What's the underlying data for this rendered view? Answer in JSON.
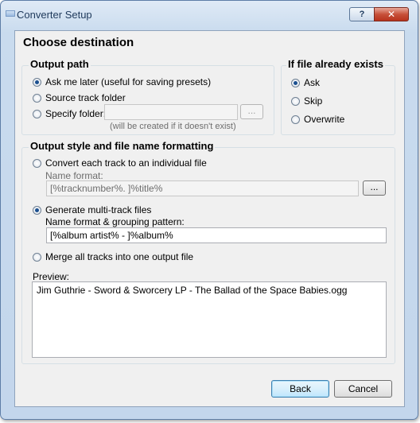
{
  "window": {
    "title": "Converter Setup",
    "help_glyph": "?",
    "close_glyph": "✕"
  },
  "heading": "Choose destination",
  "output_path": {
    "title": "Output path",
    "options": [
      {
        "label": "Ask me later (useful for saving presets)",
        "selected": true
      },
      {
        "label": "Source track folder",
        "selected": false
      },
      {
        "label": "Specify folder:",
        "selected": false
      }
    ],
    "folder_value": "",
    "browse_label": "...",
    "note": "(will be created if it doesn't exist)"
  },
  "if_exists": {
    "title": "If file already exists",
    "options": [
      {
        "label": "Ask",
        "selected": true
      },
      {
        "label": "Skip",
        "selected": false
      },
      {
        "label": "Overwrite",
        "selected": false
      }
    ]
  },
  "output_style": {
    "title": "Output style and file name formatting",
    "individual": {
      "label": "Convert each track to an individual file",
      "selected": false
    },
    "name_format_label": "Name format:",
    "name_format_value": "[%tracknumber%. ]%title%",
    "name_format_browse": "...",
    "multitrack": {
      "label": "Generate multi-track files",
      "selected": true
    },
    "grouping_label": "Name format & grouping pattern:",
    "grouping_value": "[%album artist% - ]%album%",
    "merge": {
      "label": "Merge all tracks into one output file",
      "selected": false
    },
    "preview_label": "Preview:",
    "preview_text": "Jim Guthrie - Sword & Sworcery LP - The Ballad of the Space Babies.ogg"
  },
  "buttons": {
    "back": "Back",
    "cancel": "Cancel"
  }
}
